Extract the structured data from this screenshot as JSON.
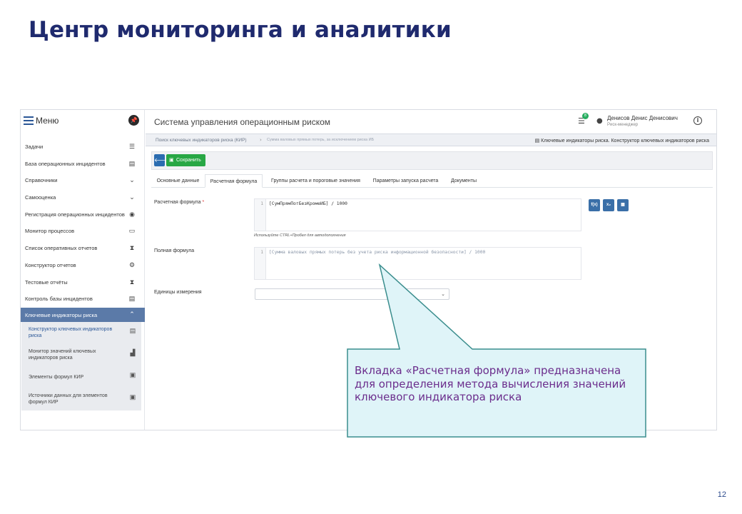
{
  "slide": {
    "title": "Центр мониторинга и аналитики",
    "page_number": "12"
  },
  "sidebar": {
    "menu_title": "Меню",
    "items": [
      {
        "label": "Задачи",
        "icon": "list-icon"
      },
      {
        "label": "База операционных инцидентов",
        "icon": "table-icon"
      },
      {
        "label": "Справочники",
        "icon": "chevron-down-icon"
      },
      {
        "label": "Самооценка",
        "icon": "chevron-down-icon"
      },
      {
        "label": "Регистрация операционных инцидентов",
        "icon": "record-icon"
      },
      {
        "label": "Монитор процессов",
        "icon": "monitor-icon"
      },
      {
        "label": "Список оперативных отчетов",
        "icon": "hourglass-icon"
      },
      {
        "label": "Конструктор отчетов",
        "icon": "gears-icon"
      },
      {
        "label": "Тестовые отчёты",
        "icon": "hourglass-icon"
      },
      {
        "label": "Контроль базы инцидентов",
        "icon": "table-icon"
      }
    ],
    "active_group": {
      "label": "Ключевые индикаторы риска",
      "icon": "chevron-up-icon"
    },
    "sub_items": [
      {
        "label": "Конструктор ключевых индикаторов риска",
        "icon": "table-icon"
      },
      {
        "label": "Монитор значений ключевых индикаторов риска",
        "icon": "chart-icon"
      },
      {
        "label": "Элементы формул КИР",
        "icon": "book-icon"
      },
      {
        "label": "Источники данных для элементов формул КИР",
        "icon": "book-icon"
      }
    ]
  },
  "header": {
    "system_title": "Система управления операционным риском",
    "notifications_count": "8",
    "user_name": "Денисов Денис Денисович",
    "user_role": "Риск-менеджер"
  },
  "breadcrumb": {
    "crumb1": "Поиск ключевых индикаторов риска (КИР)",
    "crumb2": "Сумма валовых прямых потерь, за исключением риска ИБ",
    "right": "Ключевые индикаторы риска. Конструктор ключевых индикаторов риска"
  },
  "toolbar": {
    "save_label": "Сохранить"
  },
  "tabs": [
    "Основные данные",
    "Расчетная формула",
    "Группы расчета и пороговые значения",
    "Параметры запуска расчета",
    "Документы"
  ],
  "form": {
    "formula_label": "Расчетная формула",
    "formula_code": "[СумПрямПотБезКромеИБ] / 1000",
    "hint": "Используйте CTRL+Пробел для автодополнения",
    "full_formula_label": "Полная формула",
    "full_formula_code": "[Сумма валовых прямых потерь без учета риска информационной безопасности] / 1000",
    "units_label": "Единицы измерения",
    "units_value": "",
    "line_number": "1",
    "formula_buttons": [
      "f(x)",
      "x₂",
      "▦"
    ]
  },
  "callout": {
    "text": "Вкладка «Расчетная формула» предназначена для определения метода вычисления значений ключевого индикатора риска",
    "text_color": "#6b2d8c",
    "fill_color": "#dff4f8",
    "border_color": "#3a8d8d"
  }
}
